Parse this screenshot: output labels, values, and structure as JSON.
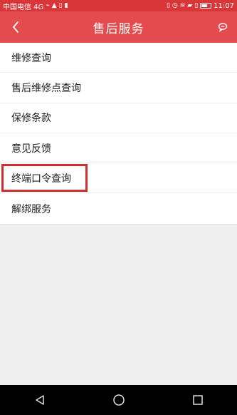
{
  "status_bar": {
    "carrier": "中国电信 4G",
    "time": "11:07"
  },
  "header": {
    "title": "售后服务",
    "back_icon": "chevron-left-icon",
    "message_icon": "message-icon"
  },
  "menu": {
    "items": [
      {
        "label": "维修查询"
      },
      {
        "label": "售后维修点查询"
      },
      {
        "label": "保修条款"
      },
      {
        "label": "意见反馈"
      },
      {
        "label": "终端口令查询"
      },
      {
        "label": "解绑服务"
      }
    ]
  },
  "android_nav": {
    "back_icon": "triangle-back-icon",
    "home_icon": "circle-home-icon",
    "recent_icon": "square-recent-icon"
  },
  "colors": {
    "status_bar": "#d9363a",
    "header": "#e44b4f",
    "highlight": "#cf2f2f"
  }
}
